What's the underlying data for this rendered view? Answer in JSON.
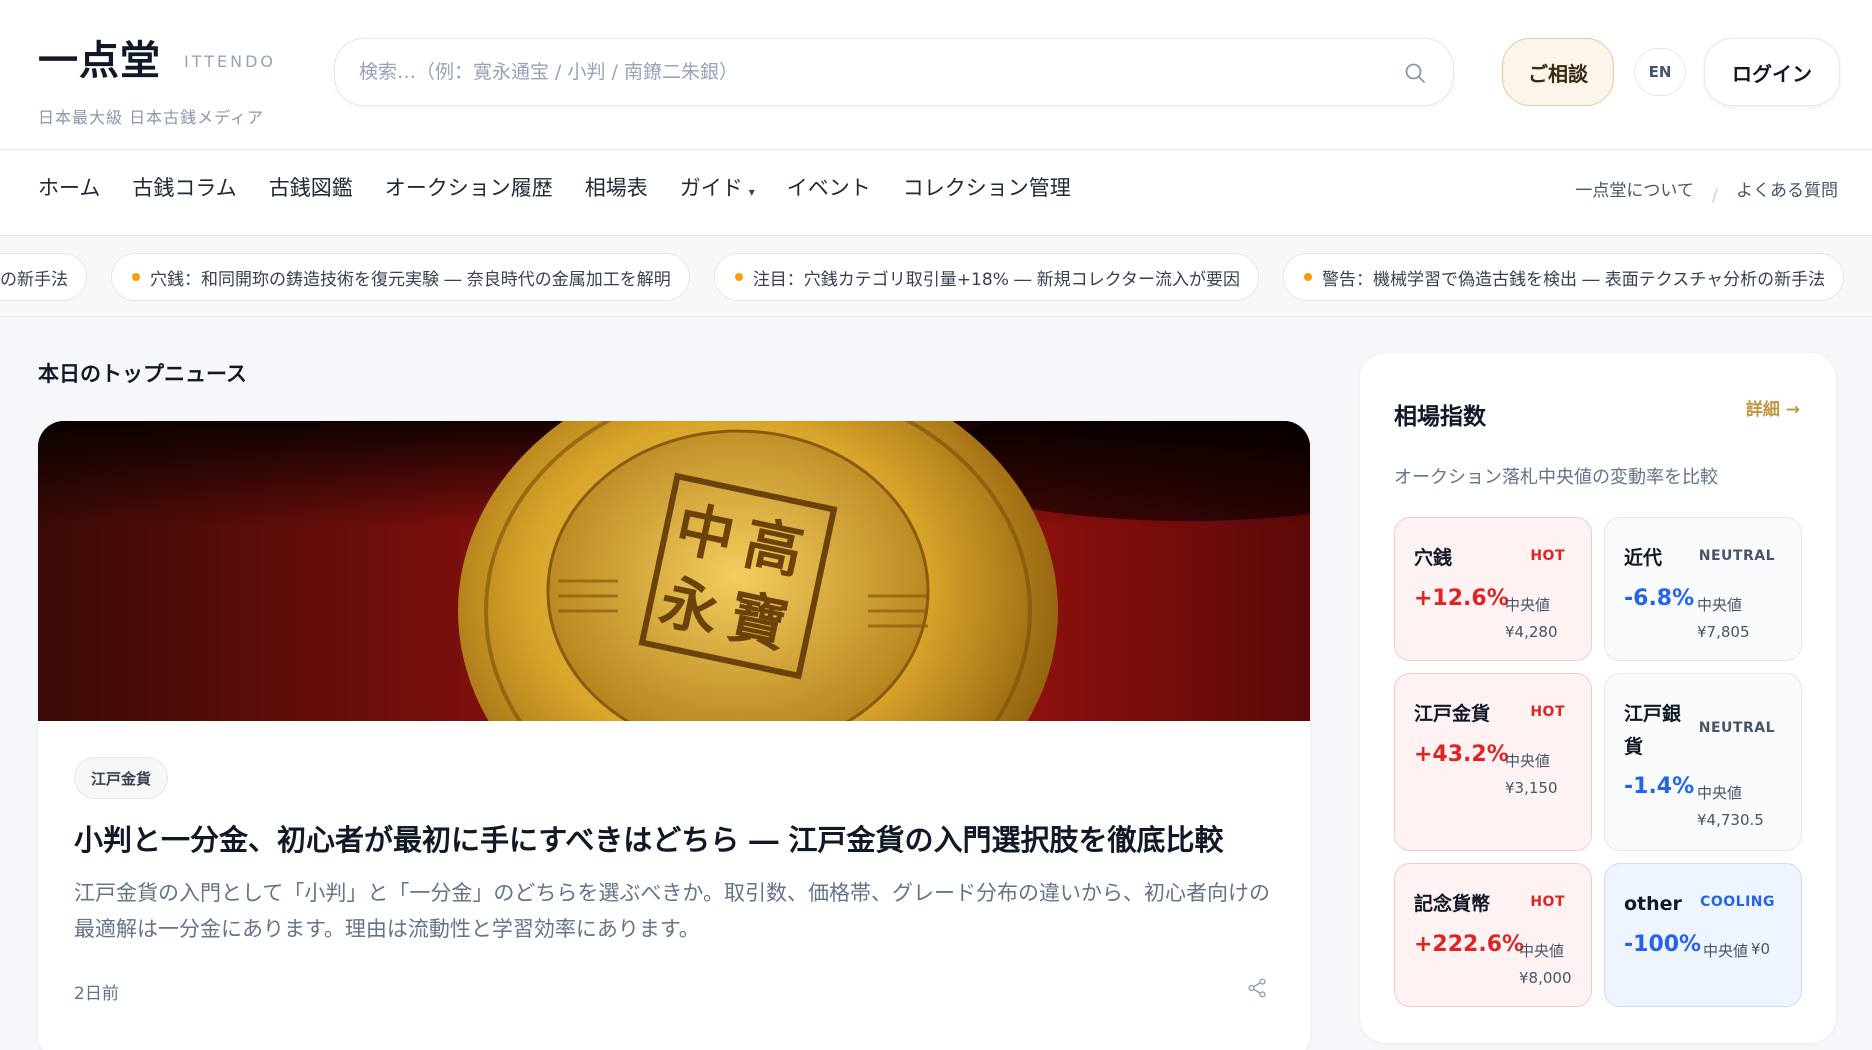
{
  "brand": {
    "name": "一点堂",
    "roman": "ITTENDO",
    "tagline": "日本最大級 日本古銭メディア"
  },
  "search": {
    "placeholder": "検索…（例：寛永通宝 / 小判 / 南鐐二朱銀）"
  },
  "header_actions": {
    "consult": "ご相談",
    "lang": "EN",
    "login": "ログイン"
  },
  "nav": {
    "items": [
      {
        "label": "ホーム"
      },
      {
        "label": "古銭コラム"
      },
      {
        "label": "古銭図鑑"
      },
      {
        "label": "オークション履歴"
      },
      {
        "label": "相場表"
      },
      {
        "label": "ガイド"
      },
      {
        "label": "イベント"
      },
      {
        "label": "コレクション管理"
      }
    ],
    "right": {
      "about": "一点堂について",
      "sep": "/",
      "faq": "よくある質問"
    }
  },
  "ticker": [
    "の新手法",
    "穴銭：和同開珎の鋳造技術を復元実験 ― 奈良時代の金属加工を解明",
    "注目：穴銭カテゴリ取引量+18% ― 新規コレクター流入が要因",
    "警告：機械学習で偽造古銭を検出 ― 表面テクスチャ分析の新手法"
  ],
  "main": {
    "section_title": "本日のトップニュース",
    "article": {
      "image_alt": "寛永通宝風の金色の古銭",
      "tag": "江戸金貨",
      "title": "小判と一分金、初心者が最初に手にすべきはどちら ― 江戸金貨の入門選択肢を徹底比較",
      "description": "江戸金貨の入門として「小判」と「一分金」のどちらを選ぶべきか。取引数、価格帯、グレード分布の違いから、初心者向けの最適解は一分金にあります。理由は流動性と学習効率にあります。",
      "time": "2日前"
    }
  },
  "market": {
    "title": "相場指数",
    "detail_link": "詳細 →",
    "subtitle": "オークション落札中央値の変動率を比較",
    "median_label": "中央値",
    "cards": [
      {
        "name": "穴銭",
        "status": "HOT",
        "change": "+12.6%",
        "price": "¥4,280"
      },
      {
        "name": "近代",
        "status": "NEUTRAL",
        "change": "-6.8%",
        "price": "¥7,805"
      },
      {
        "name": "江戸金貨",
        "status": "HOT",
        "change": "+43.2%",
        "price": "¥3,150"
      },
      {
        "name": "江戸銀\n貨",
        "status": "NEUTRAL",
        "change": "-1.4%",
        "price": "¥4,730.5"
      },
      {
        "name": "記念貨幣",
        "status": "HOT",
        "change": "+222.6%",
        "price": "¥8,000"
      },
      {
        "name": "other",
        "status": "COOLING",
        "change": "-100%",
        "price": "¥0"
      }
    ]
  },
  "colors": {
    "accent_gold": "#c09440",
    "hot": "#dc2626",
    "cool": "#2563eb",
    "ticker_dot": "#f59e0b"
  }
}
